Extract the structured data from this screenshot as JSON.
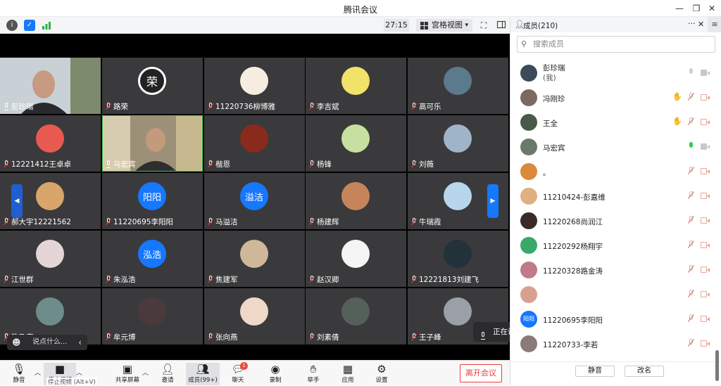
{
  "window": {
    "title": "腾讯会议",
    "minimize": "—",
    "restore": "❐",
    "close": "✕"
  },
  "toolbar": {
    "timer": "27:15",
    "view_label": "宫格视图",
    "view_caret": "▾"
  },
  "tiles": [
    {
      "name": "彭珍瑞",
      "mic": "on",
      "video": true,
      "bg": "#3a3a3c"
    },
    {
      "name": "路荣",
      "mic": "off",
      "avatar_text": "荣",
      "av_bg": "#222",
      "av_fg": "#fff"
    },
    {
      "name": "11220736柳博雅",
      "mic": "off",
      "av_bg": "#f4ede0"
    },
    {
      "name": "李吉斌",
      "mic": "off",
      "av_bg": "#f3e26a"
    },
    {
      "name": "高可乐",
      "mic": "off",
      "av_bg": "#5b7a8c"
    },
    {
      "name": "12221412王卓卓",
      "mic": "off",
      "av_bg": "#e85a4f"
    },
    {
      "name": "马宏宾",
      "mic": "on",
      "video": true
    },
    {
      "name": "楷恩",
      "mic": "off",
      "av_bg": "#8a2a1c"
    },
    {
      "name": "杨锋",
      "mic": "off",
      "av_bg": "#c7e0a0"
    },
    {
      "name": "刘薇",
      "mic": "off",
      "av_bg": "#9fb4c9"
    },
    {
      "name": "郝大宇12221562",
      "mic": "off",
      "av_bg": "#d8a66a"
    },
    {
      "name": "11220695李阳阳",
      "mic": "off",
      "avatar_text": "阳阳",
      "av_bg": "#1677ff",
      "av_fg": "#fff"
    },
    {
      "name": "马溢洁",
      "mic": "off",
      "avatar_text": "溢洁",
      "av_bg": "#1677ff",
      "av_fg": "#fff"
    },
    {
      "name": "杨建辉",
      "mic": "off",
      "av_bg": "#c7845a"
    },
    {
      "name": "牛瑞霞",
      "mic": "off",
      "av_bg": "#b7d6ec"
    },
    {
      "name": "江世群",
      "mic": "off",
      "av_bg": "#e4d6d6"
    },
    {
      "name": "朱泓浩",
      "mic": "off",
      "avatar_text": "泓浩",
      "av_bg": "#1677ff",
      "av_fg": "#fff"
    },
    {
      "name": "焦建军",
      "mic": "off",
      "av_bg": "#cfb89a"
    },
    {
      "name": "赵汉卿",
      "mic": "off",
      "av_bg": "#f5f5f5"
    },
    {
      "name": "12221813刘建飞",
      "mic": "off",
      "av_bg": "#23313b"
    },
    {
      "name": "陈乃康",
      "mic": "off",
      "av_bg": "#6d8c8a"
    },
    {
      "name": "牟元博",
      "mic": "off",
      "av_bg": "#4a3a3e"
    },
    {
      "name": "张向燕",
      "mic": "off",
      "av_bg": "#f0d8c8"
    },
    {
      "name": "刘素倩",
      "mic": "off",
      "av_bg": "#54605a"
    },
    {
      "name": "王子峰",
      "mic": "off",
      "av_bg": "#9aa0a6"
    }
  ],
  "speaking": {
    "label": "正在讲话: 马宏宾; 彭珍瑞;"
  },
  "chat": {
    "placeholder": "说点什么...",
    "collapse": "‹"
  },
  "bottom": {
    "mute": "静音",
    "stop_video": "停止视频",
    "share": "共享屏幕",
    "invite": "邀请",
    "members": "成员(99+)",
    "chat": "聊天",
    "chat_badge": "1",
    "record": "录制",
    "raise_hand": "举手",
    "apps": "应用",
    "settings": "设置",
    "leave": "离开会议",
    "video_tooltip": "停止视频 (Alt+V)"
  },
  "side": {
    "header": "成员(210)",
    "more": "···",
    "close": "✕",
    "menu": "≡",
    "search_placeholder": "搜索成员",
    "members": [
      {
        "name": "彭珍瑞",
        "sub": "(我)",
        "mic": "grey",
        "cam": "grey",
        "hand": false,
        "av_bg": "#3c4a5a"
      },
      {
        "name": "冯刚珍",
        "mic": "off",
        "cam": "off",
        "hand": true,
        "av_bg": "#7a6a60"
      },
      {
        "name": "王全",
        "mic": "off",
        "cam": "off",
        "hand": true,
        "av_bg": "#4a5a4a"
      },
      {
        "name": "马宏宾",
        "mic": "green",
        "cam": "grey",
        "hand": false,
        "av_bg": "#6a7a6a"
      },
      {
        "name": "。",
        "mic": "off",
        "cam": "off",
        "hand": false,
        "av_bg": "#d98a3a"
      },
      {
        "name": "11210424-彭嘉维",
        "mic": "off",
        "cam": "off",
        "hand": false,
        "av_bg": "#e0b080"
      },
      {
        "name": "11220268尚润江",
        "mic": "off",
        "cam": "off",
        "hand": false,
        "av_bg": "#3a2a2a"
      },
      {
        "name": "11220292杨翔宇",
        "mic": "off",
        "cam": "off",
        "hand": false,
        "av_bg": "#3aa86a"
      },
      {
        "name": "11220328路金涛",
        "mic": "off",
        "cam": "off",
        "hand": false,
        "av_bg": "#c07a8a"
      },
      {
        "name": "",
        "mic": "off",
        "cam": "off",
        "hand": false,
        "av_bg": "#d9a090"
      },
      {
        "name": "11220695李阳阳",
        "mic": "off",
        "cam": "off",
        "hand": false,
        "av_bg": "#1677ff",
        "avatar_text": "阳阳"
      },
      {
        "name": "11220733-李若",
        "mic": "off",
        "cam": "off",
        "hand": false,
        "av_bg": "#8a7a7a"
      }
    ],
    "mute_btn": "静音",
    "rename_btn": "改名"
  }
}
